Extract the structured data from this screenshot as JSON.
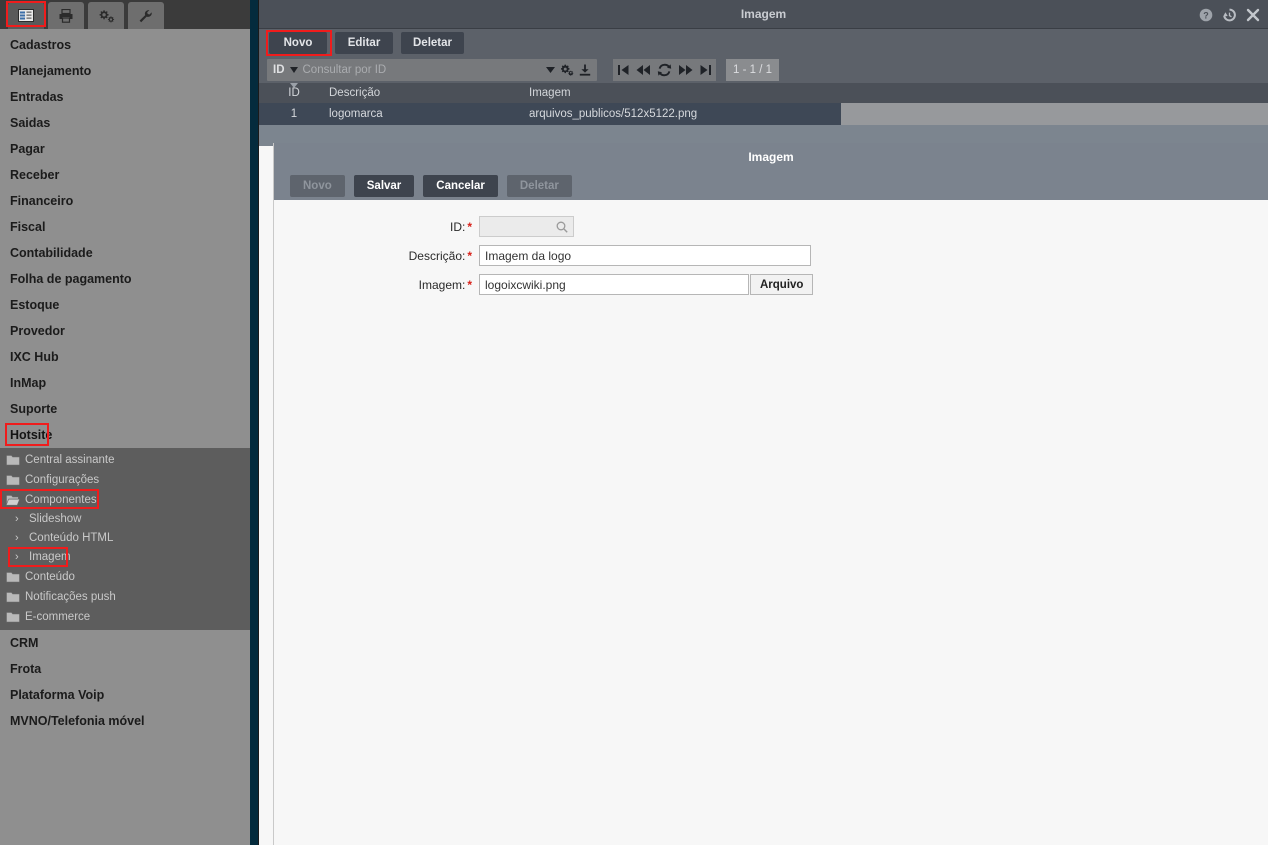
{
  "sidebar": {
    "tabs": [
      {
        "name": "list-icon",
        "label": "Menu",
        "selected": true,
        "highlighted": true
      },
      {
        "name": "printer-icon",
        "label": "Impressão",
        "selected": false,
        "highlighted": false
      },
      {
        "name": "gears-icon",
        "label": "Configurações",
        "selected": false,
        "highlighted": false
      },
      {
        "name": "wrench-icon",
        "label": "Ferramentas",
        "selected": false,
        "highlighted": false
      }
    ],
    "items": [
      {
        "label": "Cadastros"
      },
      {
        "label": "Planejamento"
      },
      {
        "label": "Entradas"
      },
      {
        "label": "Saidas"
      },
      {
        "label": "Pagar"
      },
      {
        "label": "Receber"
      },
      {
        "label": "Financeiro"
      },
      {
        "label": "Fiscal"
      },
      {
        "label": "Contabilidade"
      },
      {
        "label": "Folha de pagamento"
      },
      {
        "label": "Estoque"
      },
      {
        "label": "Provedor"
      },
      {
        "label": "IXC Hub"
      },
      {
        "label": "InMap"
      },
      {
        "label": "Suporte"
      },
      {
        "label": "Hotsite",
        "highlighted": true
      }
    ],
    "submenu": [
      {
        "label": "Central assinante",
        "icon": "folder-closed-icon",
        "level": 1
      },
      {
        "label": "Configurações",
        "icon": "folder-closed-icon",
        "level": 1
      },
      {
        "label": "Componentes",
        "icon": "folder-open-icon",
        "level": 1,
        "highlighted": true
      },
      {
        "label": "Slideshow",
        "icon": "chevron-right-icon",
        "level": 2
      },
      {
        "label": "Conteúdo HTML",
        "icon": "chevron-right-icon",
        "level": 2
      },
      {
        "label": "Imagem",
        "icon": "chevron-right-icon",
        "level": 2,
        "highlighted": true
      },
      {
        "label": "Conteúdo",
        "icon": "folder-closed-icon",
        "level": 1
      },
      {
        "label": "Notificações push",
        "icon": "folder-closed-icon",
        "level": 1
      },
      {
        "label": "E-commerce",
        "icon": "folder-closed-icon",
        "level": 1
      }
    ],
    "items_bottom": [
      {
        "label": "CRM"
      },
      {
        "label": "Frota"
      },
      {
        "label": "Plataforma Voip"
      },
      {
        "label": "MVNO/Telefonia móvel"
      }
    ]
  },
  "window": {
    "title": "Imagem",
    "icons": [
      {
        "name": "help-icon",
        "glyph": "?"
      },
      {
        "name": "history-icon",
        "glyph": "↺"
      },
      {
        "name": "close-icon",
        "glyph": "✕"
      }
    ]
  },
  "toolbar": {
    "novo": "Novo",
    "editar": "Editar",
    "deletar": "Deletar"
  },
  "search": {
    "field_label": "ID",
    "placeholder": "Consultar por ID",
    "icons": [
      "caret-down-icon",
      "gears-icon",
      "download-icon"
    ]
  },
  "pager": {
    "first": "first-page-icon",
    "prev": "prev-page-icon",
    "refresh": "refresh-icon",
    "next": "next-page-icon",
    "last": "last-page-icon",
    "count": "1 - 1 / 1"
  },
  "grid": {
    "columns": [
      "ID",
      "Descrição",
      "Imagem"
    ],
    "rows": [
      {
        "id": "1",
        "descricao": "logomarca",
        "imagem": "arquivos_publicos/512x5122.png"
      }
    ]
  },
  "form": {
    "title": "Imagem",
    "buttons": {
      "novo": "Novo",
      "salvar": "Salvar",
      "cancelar": "Cancelar",
      "deletar": "Deletar"
    },
    "fields": {
      "id_label": "ID:",
      "id_value": "",
      "descricao_label": "Descrição:",
      "descricao_value": "Imagem da logo",
      "imagem_label": "Imagem:",
      "imagem_value": "logoixcwiki.png",
      "arquivo_button": "Arquivo"
    }
  },
  "colors": {
    "highlight_red": "#f01c1c",
    "required_red": "#d8211a",
    "sidebar_bg": "#8f8f8f",
    "submenu_bg": "#5d5d5d",
    "header_bg": "#4b5058",
    "toolbar_bg": "#5c6169",
    "form_header_bg": "#7b838e",
    "row_selected_bg": "#3e4856",
    "navy_strip": "#042b3d"
  }
}
